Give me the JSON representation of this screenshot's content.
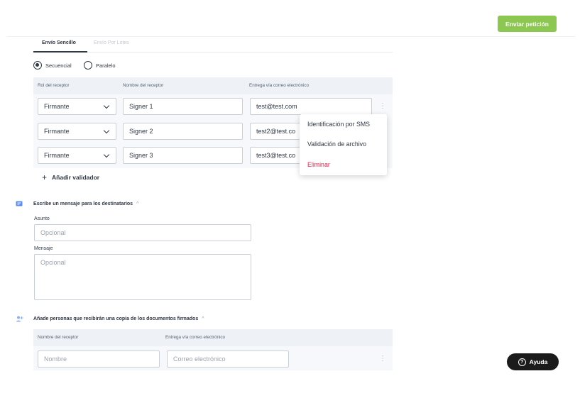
{
  "header": {
    "send_button": "Enviar petición"
  },
  "tabs": [
    {
      "label": "Envío Sencillo",
      "active": true
    },
    {
      "label": "Envío Por Lotes",
      "active": false
    }
  ],
  "order": {
    "options": [
      {
        "label": "Secuencial",
        "checked": true
      },
      {
        "label": "Paralelo",
        "checked": false
      }
    ]
  },
  "recipients": {
    "headers": [
      "Rol del receptor",
      "Nombre del receptor",
      "Entrega vía correo electrónico"
    ],
    "rows": [
      {
        "role": "Firmante",
        "name": "Signer 1",
        "email": "test@test.com"
      },
      {
        "role": "Firmante",
        "name": "Signer 2",
        "email": "test2@test.co"
      },
      {
        "role": "Firmante",
        "name": "Signer 3",
        "email": "test3@test.co"
      }
    ],
    "add_validator": "Añadir validador",
    "kebab": "⋮"
  },
  "row_menu": {
    "items": [
      {
        "label": "Identificación por SMS"
      },
      {
        "label": "Validación de archivo"
      },
      {
        "label": "Eliminar",
        "danger": true
      }
    ]
  },
  "message_section": {
    "title": "Escribe un mensaje para los destinatarios",
    "caret": "^",
    "subject_label": "Asunto",
    "subject_placeholder": "Opcional",
    "message_label": "Mensaje",
    "message_placeholder": "Opcional"
  },
  "copy_section": {
    "title": "Añade personas que recibirán una copia de los documentos firmados",
    "caret": "^",
    "headers": [
      "Nombre del receptor",
      "Entrega vía correo electrónico"
    ],
    "name_placeholder": "Nombre",
    "email_placeholder": "Correo electrónico",
    "kebab": "⋮"
  },
  "help": {
    "label": "Ayuda",
    "icon_char": "?"
  },
  "colors": {
    "accent": "#8cc751",
    "danger": "#e0234e",
    "dark": "#2f3845",
    "section_icon": "#5b8def"
  }
}
